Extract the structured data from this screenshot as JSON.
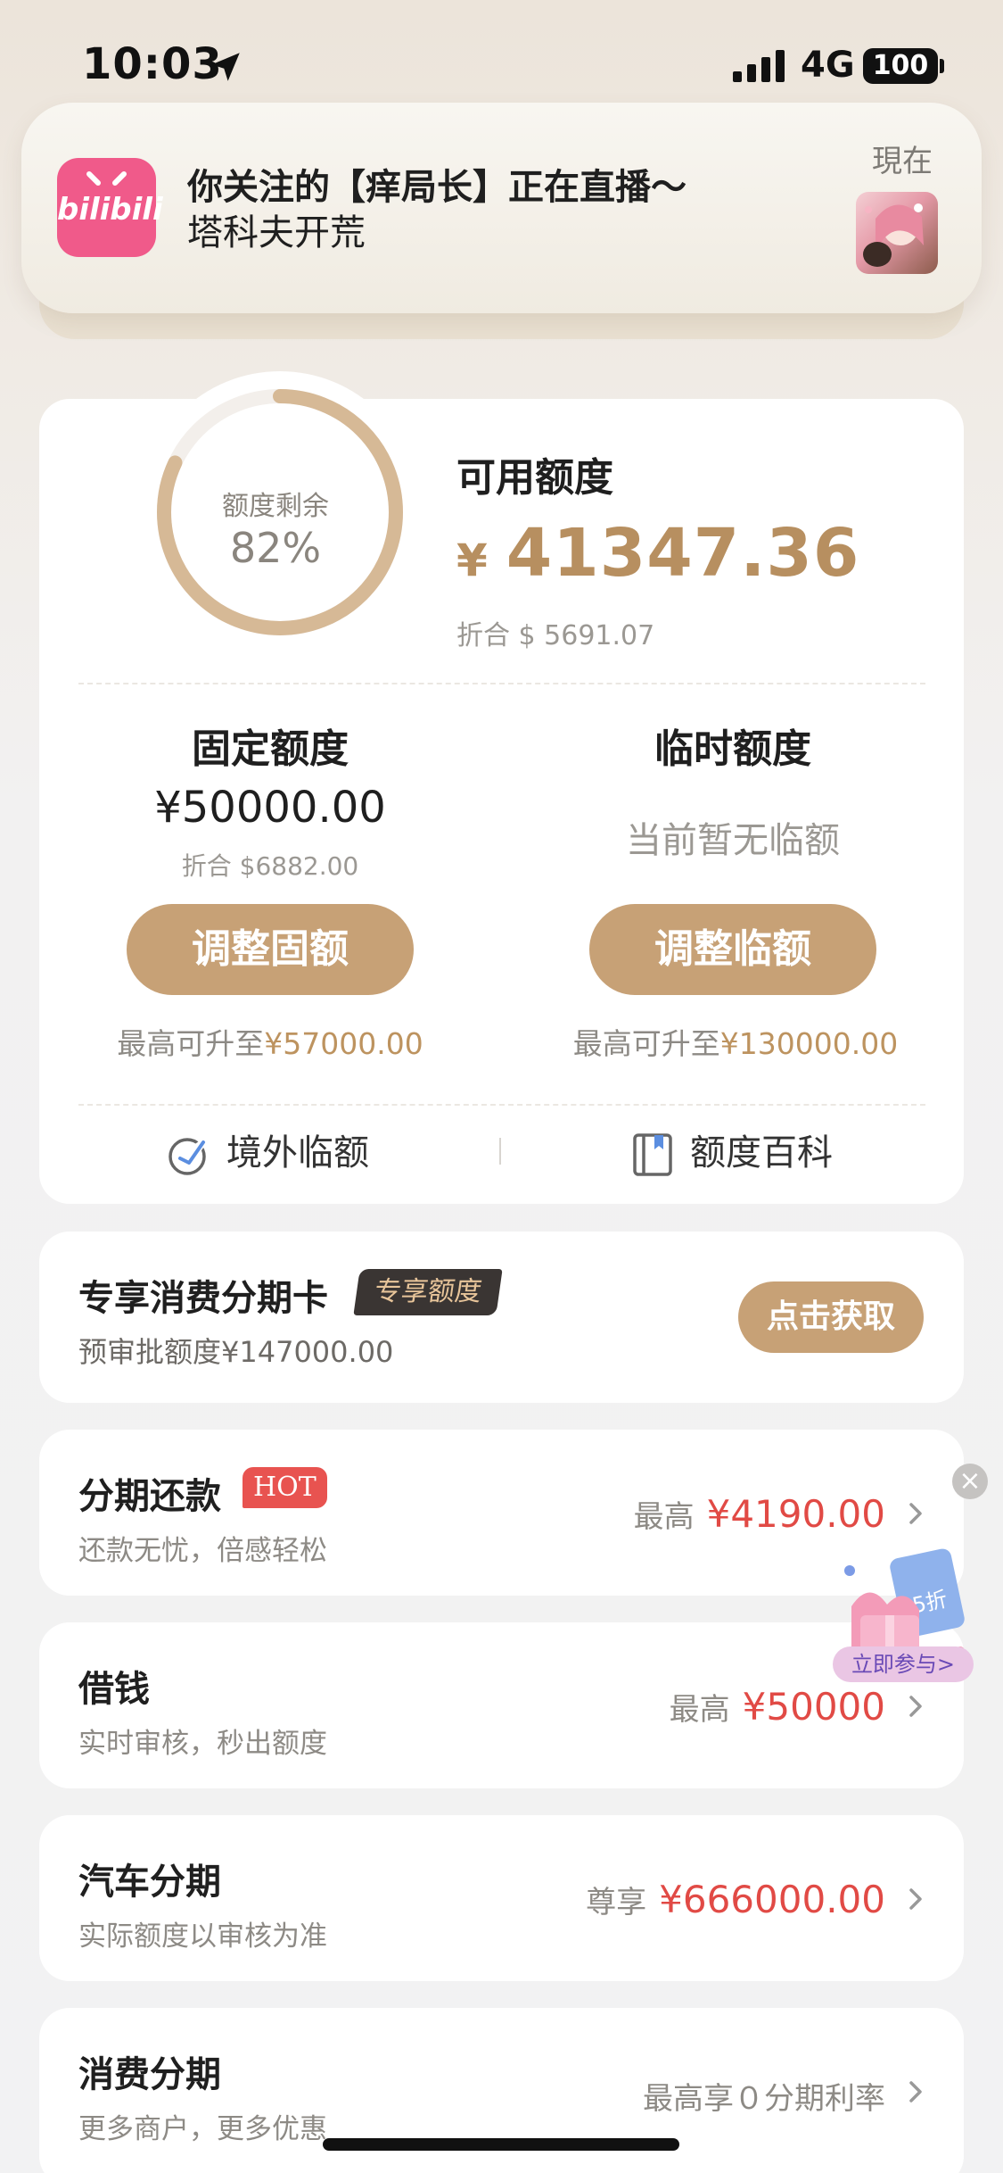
{
  "status_bar": {
    "time": "10:03",
    "network": "4G",
    "battery": "100"
  },
  "notification": {
    "app": "bilibili",
    "title": "你关注的【痒局长】正在直播～",
    "body": "塔科夫开荒",
    "time": "現在"
  },
  "quota": {
    "ring_label": "额度剩余",
    "ring_percent": "82%",
    "ring_fraction": 0.82,
    "available_title": "可用额度",
    "currency": "¥",
    "available_amount": "41347.36",
    "available_usd": "折合 $ 5691.07",
    "fixed": {
      "title": "固定额度",
      "amount": "¥50000.00",
      "usd": "折合 $6882.00",
      "button": "调整固额",
      "max_prefix": "最高可升至",
      "max_value": "¥57000.00"
    },
    "temporary": {
      "title": "临时额度",
      "none_text": "当前暂无临额",
      "button": "调整临额",
      "max_prefix": "最高可升至",
      "max_value": "¥130000.00"
    },
    "links": {
      "overseas": "境外临额",
      "wiki": "额度百科"
    }
  },
  "promo": {
    "title": "专享消费分期卡",
    "tag": "专享额度",
    "subtitle": "预审批额度¥147000.00",
    "button": "点击获取"
  },
  "list": [
    {
      "title": "分期还款",
      "badge": "HOT",
      "subtitle": "还款无忧，倍感轻松",
      "prefix": "最高",
      "amount": "¥4190.00"
    },
    {
      "title": "借钱",
      "subtitle": "实时审核，秒出额度",
      "prefix": "最高",
      "amount": "¥50000"
    },
    {
      "title": "汽车分期",
      "subtitle": "实际额度以审核为准",
      "prefix": "尊享",
      "amount": "¥666000.00"
    },
    {
      "title": "消费分期",
      "subtitle": "更多商户，更多优惠",
      "plain": "最高享０分期利率"
    }
  ],
  "floating": {
    "discount": "5折",
    "label": "立即参与>"
  },
  "colors": {
    "gold": "#c7a176",
    "gold_text": "#b78f60",
    "red": "#e14a45",
    "bilibili_pink": "#f05a8a"
  }
}
